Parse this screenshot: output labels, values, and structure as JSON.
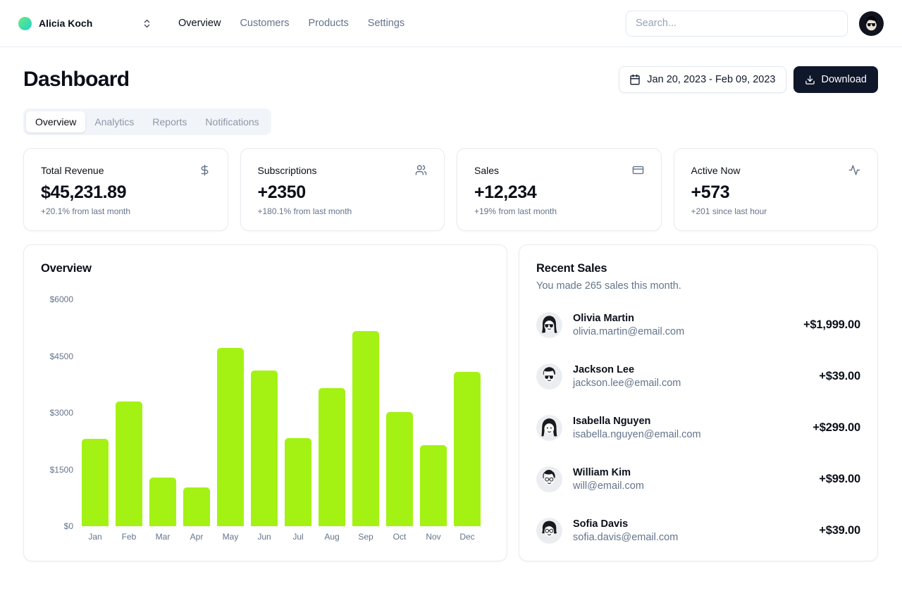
{
  "header": {
    "team_name": "Alicia Koch",
    "nav_links": [
      {
        "label": "Overview",
        "active": true
      },
      {
        "label": "Customers",
        "active": false
      },
      {
        "label": "Products",
        "active": false
      },
      {
        "label": "Settings",
        "active": false
      }
    ],
    "search_placeholder": "Search..."
  },
  "page": {
    "title": "Dashboard",
    "date_range": "Jan 20, 2023 - Feb 09, 2023",
    "download_label": "Download"
  },
  "tabs": [
    {
      "label": "Overview",
      "active": true
    },
    {
      "label": "Analytics",
      "active": false
    },
    {
      "label": "Reports",
      "active": false
    },
    {
      "label": "Notifications",
      "active": false
    }
  ],
  "stats": [
    {
      "label": "Total Revenue",
      "icon": "dollar-sign-icon",
      "value": "$45,231.89",
      "note": "+20.1% from last month"
    },
    {
      "label": "Subscriptions",
      "icon": "users-icon",
      "value": "+2350",
      "note": "+180.1% from last month"
    },
    {
      "label": "Sales",
      "icon": "credit-card-icon",
      "value": "+12,234",
      "note": "+19% from last month"
    },
    {
      "label": "Active Now",
      "icon": "activity-icon",
      "value": "+573",
      "note": "+201 since last hour"
    }
  ],
  "chart_data": {
    "type": "bar",
    "title": "Overview",
    "categories": [
      "Jan",
      "Feb",
      "Mar",
      "Apr",
      "May",
      "Jun",
      "Jul",
      "Aug",
      "Sep",
      "Oct",
      "Nov",
      "Dec"
    ],
    "values": [
      2320,
      3300,
      1290,
      1030,
      4720,
      4120,
      2330,
      3650,
      5160,
      3020,
      2140,
      4080
    ],
    "xlabel": "",
    "ylabel": "",
    "ylim": [
      0,
      6000
    ],
    "yticks": [
      0,
      1500,
      3000,
      4500,
      6000
    ],
    "ytick_labels": [
      "$0",
      "$1500",
      "$3000",
      "$4500",
      "$6000"
    ],
    "bar_color": "#a3f213",
    "grid": false,
    "legend": false
  },
  "recent_sales": {
    "title": "Recent Sales",
    "subtitle": "You made 265 sales this month.",
    "items": [
      {
        "name": "Olivia Martin",
        "email": "olivia.martin@email.com",
        "amount": "+$1,999.00",
        "avatar": "olivia-martin-avatar-icon",
        "avatar_style": "bob-sunglasses"
      },
      {
        "name": "Jackson Lee",
        "email": "jackson.lee@email.com",
        "amount": "+$39.00",
        "avatar": "jackson-lee-avatar-icon",
        "avatar_style": "short-sunglasses"
      },
      {
        "name": "Isabella Nguyen",
        "email": "isabella.nguyen@email.com",
        "amount": "+$299.00",
        "avatar": "isabella-nguyen-avatar-icon",
        "avatar_style": "long-hair"
      },
      {
        "name": "William Kim",
        "email": "will@email.com",
        "amount": "+$99.00",
        "avatar": "william-kim-avatar-icon",
        "avatar_style": "quiff-glasses"
      },
      {
        "name": "Sofia Davis",
        "email": "sofia.davis@email.com",
        "amount": "+$39.00",
        "avatar": "sofia-davis-avatar-icon",
        "avatar_style": "curly-glasses"
      }
    ]
  },
  "colors": {
    "bar_accent": "#a3f213",
    "primary_dark": "#0f172a",
    "muted_text": "#64748b",
    "border": "#e8ebf0",
    "tabs_bg": "#f1f5f9",
    "team_avatar_start": "#63e889",
    "team_avatar_end": "#2bd4c0"
  }
}
